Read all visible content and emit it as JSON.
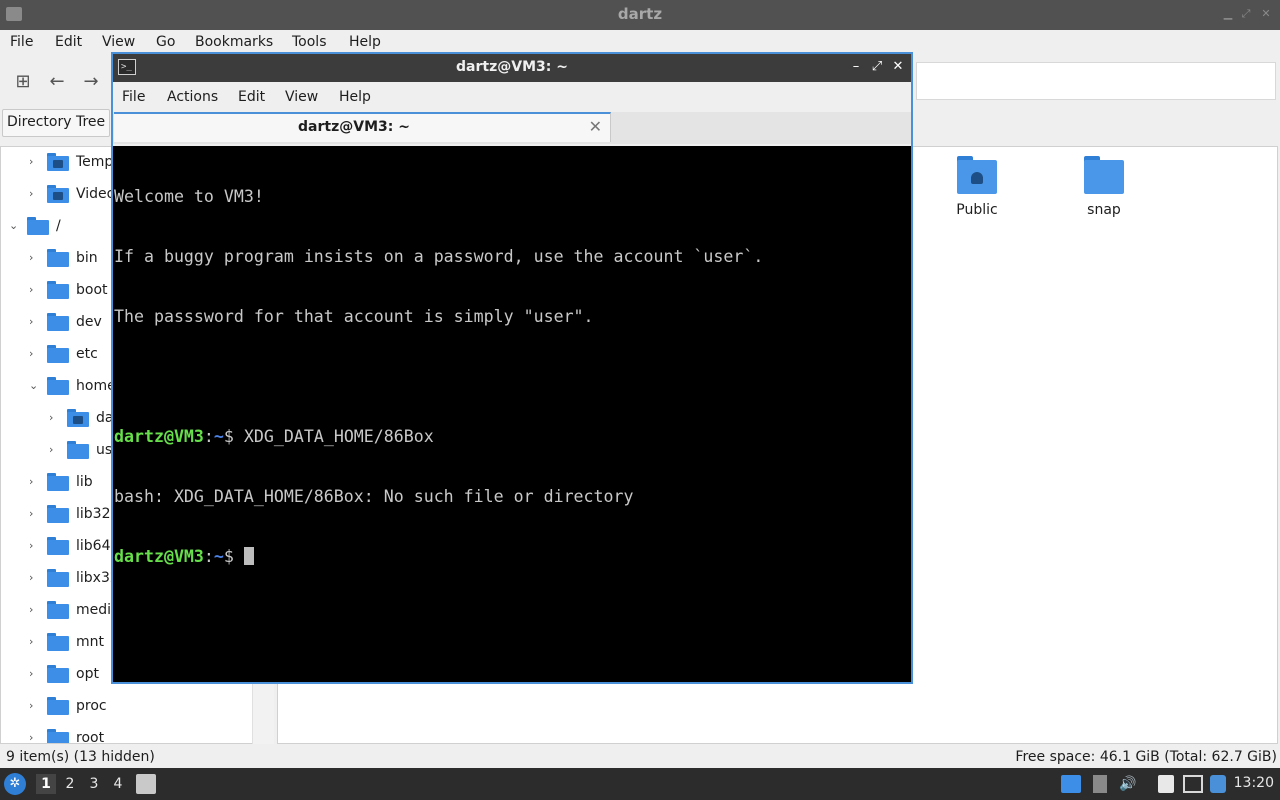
{
  "file_manager": {
    "title": "dartz",
    "menu": [
      "File",
      "Edit",
      "View",
      "Go",
      "Bookmarks",
      "Tools",
      "Help"
    ],
    "side_pane_mode": "Directory Tree",
    "tree": [
      {
        "label": "Temp",
        "expanded": false
      },
      {
        "label": "Video",
        "expanded": false
      },
      {
        "label": "/",
        "expanded": true
      },
      {
        "label": "bin",
        "expanded": false
      },
      {
        "label": "boot",
        "expanded": false
      },
      {
        "label": "dev",
        "expanded": false
      },
      {
        "label": "etc",
        "expanded": false
      },
      {
        "label": "home",
        "expanded": true
      },
      {
        "label": "da",
        "expanded": false
      },
      {
        "label": "us",
        "expanded": false
      },
      {
        "label": "lib",
        "expanded": false
      },
      {
        "label": "lib32",
        "expanded": false
      },
      {
        "label": "lib64",
        "expanded": false
      },
      {
        "label": "libx32",
        "expanded": false
      },
      {
        "label": "medi",
        "expanded": false
      },
      {
        "label": "mnt",
        "expanded": false
      },
      {
        "label": "opt",
        "expanded": false
      },
      {
        "label": "proc",
        "expanded": false
      },
      {
        "label": "root",
        "expanded": false
      }
    ],
    "content_items": [
      {
        "label": "Public",
        "icon": "folder-public-icon"
      },
      {
        "label": "snap",
        "icon": "folder-icon"
      }
    ],
    "status_left": "9 item(s) (13 hidden)",
    "status_right": "Free space: 46.1 GiB (Total: 62.7 GiB)"
  },
  "terminal": {
    "title": "dartz@VM3: ~",
    "menu": [
      "File",
      "Actions",
      "Edit",
      "View",
      "Help"
    ],
    "tab_label": "dartz@VM3: ~",
    "lines": [
      {
        "type": "text",
        "text": "Welcome to VM3!"
      },
      {
        "type": "text",
        "text": "If a buggy program insists on a password, use the account `user`."
      },
      {
        "type": "text",
        "text": "The passsword for that account is simply \"user\"."
      },
      {
        "type": "text",
        "text": ""
      },
      {
        "type": "prompt",
        "user": "dartz@VM3",
        "path": "~",
        "symbol": "$",
        "command": " XDG_DATA_HOME/86Box"
      },
      {
        "type": "text",
        "text": "bash: XDG_DATA_HOME/86Box: No such file or directory"
      },
      {
        "type": "prompt",
        "user": "dartz@VM3",
        "path": "~",
        "symbol": "$",
        "command": " ",
        "cursor": true
      }
    ]
  },
  "taskbar": {
    "workspaces": [
      "1",
      "2",
      "3",
      "4"
    ],
    "active_workspace": "1",
    "clock": "13:20"
  },
  "colors": {
    "accent": "#4a90d9",
    "folder": "#3d8ee6",
    "prompt_user": "#66e04a",
    "prompt_path": "#4a82e6"
  }
}
